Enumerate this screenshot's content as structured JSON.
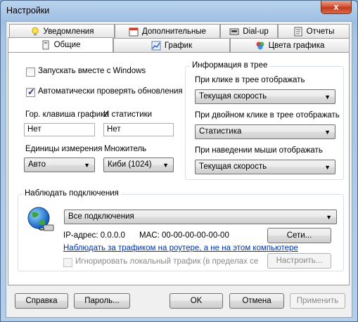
{
  "window": {
    "title": "Настройки",
    "close_glyph": "x"
  },
  "tabs": {
    "row1": [
      {
        "label": "Уведомления",
        "icon": "lightbulb-icon"
      },
      {
        "label": "Дополнительные",
        "icon": "calendar-icon"
      },
      {
        "label": "Dial-up",
        "icon": "dialup-icon"
      },
      {
        "label": "Отчеты",
        "icon": "report-icon"
      }
    ],
    "row2": [
      {
        "label": "Общие",
        "icon": "general-icon"
      },
      {
        "label": "График",
        "icon": "chart-icon"
      },
      {
        "label": "Цвета графика",
        "icon": "palette-icon"
      }
    ],
    "active": "Общие"
  },
  "general": {
    "autostart": {
      "label": "Запускать вместе с Windows",
      "checked": false
    },
    "autoupdate": {
      "label": "Автоматически проверять обновления",
      "checked": true
    },
    "hotkey_graph_label": "Гор. клавиша графика",
    "hotkey_graph_value": "Нет",
    "hotkey_stats_label": "И статистики",
    "hotkey_stats_value": "Нет",
    "units_label": "Единицы измерения",
    "units_value": "Авто",
    "multiplier_label": "Множитель",
    "multiplier_value": "Киби (1024)"
  },
  "tray": {
    "title": "Информация в трее",
    "click_label": "При клике в трее отображать",
    "click_value": "Текущая скорость",
    "dblclick_label": "При двойном клике в трее отображать",
    "dblclick_value": "Статистика",
    "hover_label": "При наведении мыши отображать",
    "hover_value": "Текущая скорость"
  },
  "connections": {
    "title": "Наблюдать подключения",
    "select_value": "Все подключения",
    "ip_text": "IP-адрес: 0.0.0.0",
    "mac_text": "MAC: 00-00-00-00-00-00",
    "networks_button": "Сети...",
    "router_link": "Наблюдать за трафиком на роутере, а не на этом компьютере",
    "ignore_local": {
      "label": "Игнорировать локальный трафик (в пределах сети)",
      "checked": false
    },
    "configure_button": "Настроить..."
  },
  "buttons": {
    "help": "Справка",
    "password": "Пароль...",
    "ok": "OK",
    "cancel": "Отмена",
    "apply": "Применить"
  }
}
